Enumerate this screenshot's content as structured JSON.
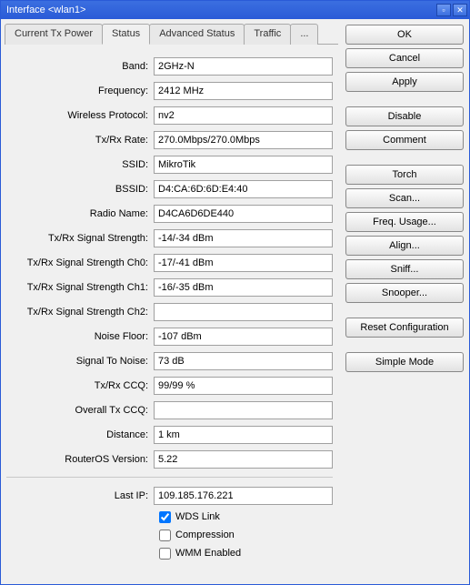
{
  "title": "Interface <wlan1>",
  "tabs": {
    "current_tx_power": "Current Tx Power",
    "status": "Status",
    "advanced_status": "Advanced Status",
    "traffic": "Traffic",
    "more": "..."
  },
  "buttons": {
    "ok": "OK",
    "cancel": "Cancel",
    "apply": "Apply",
    "disable": "Disable",
    "comment": "Comment",
    "torch": "Torch",
    "scan": "Scan...",
    "freq_usage": "Freq. Usage...",
    "align": "Align...",
    "sniff": "Sniff...",
    "snooper": "Snooper...",
    "reset_config": "Reset Configuration",
    "simple_mode": "Simple Mode"
  },
  "fields": {
    "band": {
      "label": "Band:",
      "value": "2GHz-N"
    },
    "frequency": {
      "label": "Frequency:",
      "value": "2412 MHz"
    },
    "wireless_protocol": {
      "label": "Wireless Protocol:",
      "value": "nv2"
    },
    "txrx_rate": {
      "label": "Tx/Rx Rate:",
      "value": "270.0Mbps/270.0Mbps"
    },
    "ssid": {
      "label": "SSID:",
      "value": "MikroTik"
    },
    "bssid": {
      "label": "BSSID:",
      "value": "D4:CA:6D:6D:E4:40"
    },
    "radio_name": {
      "label": "Radio Name:",
      "value": "D4CA6D6DE440"
    },
    "txrx_signal": {
      "label": "Tx/Rx Signal Strength:",
      "value": "-14/-34 dBm"
    },
    "txrx_signal_ch0": {
      "label": "Tx/Rx Signal Strength Ch0:",
      "value": "-17/-41 dBm"
    },
    "txrx_signal_ch1": {
      "label": "Tx/Rx Signal Strength Ch1:",
      "value": "-16/-35 dBm"
    },
    "txrx_signal_ch2": {
      "label": "Tx/Rx Signal Strength Ch2:",
      "value": ""
    },
    "noise_floor": {
      "label": "Noise Floor:",
      "value": "-107 dBm"
    },
    "signal_to_noise": {
      "label": "Signal To Noise:",
      "value": "73 dB"
    },
    "txrx_ccq": {
      "label": "Tx/Rx CCQ:",
      "value": "99/99 %"
    },
    "overall_tx_ccq": {
      "label": "Overall Tx CCQ:",
      "value": ""
    },
    "distance": {
      "label": "Distance:",
      "value": "1 km"
    },
    "routeros_version": {
      "label": "RouterOS Version:",
      "value": "5.22"
    },
    "last_ip": {
      "label": "Last IP:",
      "value": "109.185.176.221"
    },
    "wds_link": {
      "label": "WDS Link",
      "checked": true
    },
    "compression": {
      "label": "Compression",
      "checked": false
    },
    "wmm_enabled": {
      "label": "WMM Enabled",
      "checked": false
    }
  },
  "titlebar_icons": {
    "min": "▫",
    "close": "✕"
  }
}
